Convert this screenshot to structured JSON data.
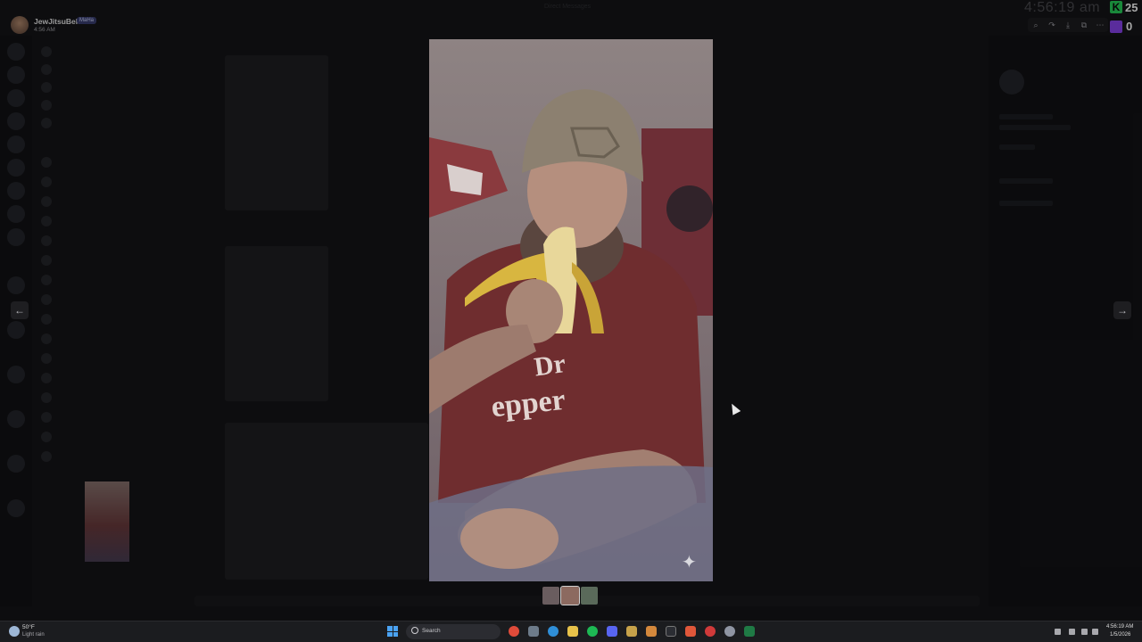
{
  "user": {
    "name": "JewJitsuBelt",
    "badge": "MaHa",
    "time": "4:56 AM"
  },
  "window_title": "Direct Messages",
  "overlay_clock": "4:56:19 am",
  "kick": {
    "letter": "K",
    "count": "25"
  },
  "twitch": {
    "count": "0"
  },
  "viewer": {
    "prev_icon": "arrow-left-icon",
    "next_icon": "arrow-right-icon",
    "media_description_icon": "sparkle-icon",
    "thumbnail_count": 3
  },
  "toolbar": {
    "items": [
      "zoom-icon",
      "reply-icon",
      "download-icon",
      "open-external-icon",
      "more-icon"
    ]
  },
  "taskbar": {
    "weather_temp": "50°F",
    "weather_desc": "Light rain",
    "search_label": "Search",
    "time": "4:56:19 AM",
    "date": "1/5/2026",
    "apps": [
      "chrome",
      "file-explorer",
      "edge",
      "spotify",
      "discord",
      "brave",
      "notepad",
      "terminal",
      "settings",
      "excel"
    ]
  },
  "colors": {
    "accent_kick": "#27d15a",
    "accent_twitch": "#8a44f0",
    "discord": "#5865f2"
  }
}
